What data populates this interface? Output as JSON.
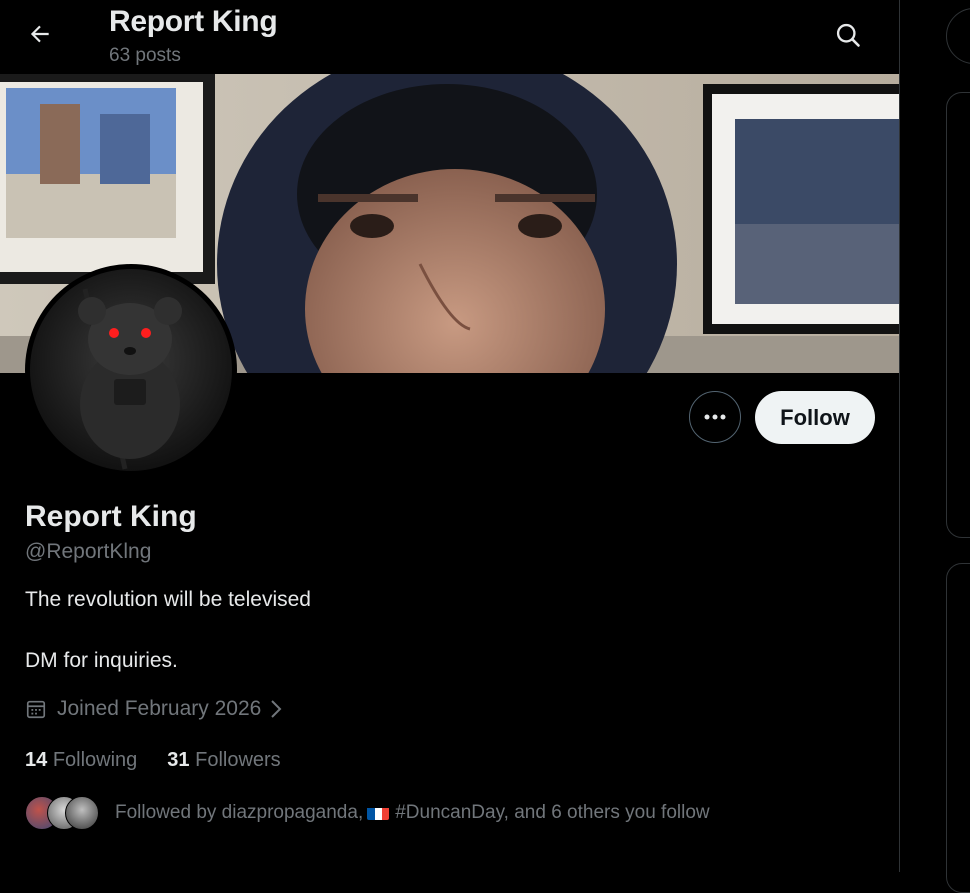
{
  "header": {
    "title": "Report King",
    "post_count": "63 posts"
  },
  "profile": {
    "name": "Report King",
    "handle": "@ReportKlng",
    "bio_line1": "The revolution will be televised",
    "bio_line2": "DM for inquiries.",
    "joined": "Joined February 2026",
    "following_count": "14",
    "following_label": "Following",
    "followers_count": "31",
    "followers_label": "Followers",
    "followed_by_prefix": "Followed by diazpropaganda,",
    "followed_by_suffix": "#DuncanDay, and 6 others you follow"
  },
  "actions": {
    "follow_label": "Follow",
    "more_icon": "more-icon"
  },
  "colors": {
    "background": "#000000",
    "text": "#e7e9ea",
    "muted": "#71767b",
    "follow_button": "#eff3f4"
  }
}
